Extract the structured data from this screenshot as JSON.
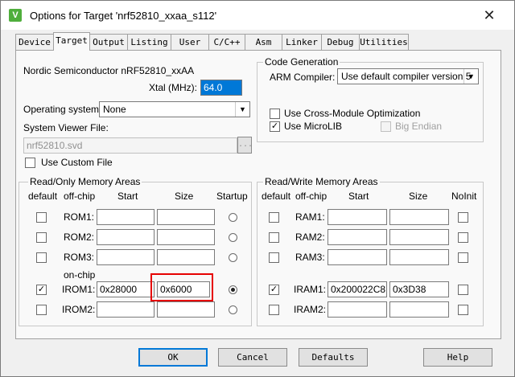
{
  "window": {
    "title": "Options for Target 'nrf52810_xxaa_s112'",
    "icon": "keil-uvision-icon",
    "close": "✕"
  },
  "tabs": [
    {
      "label": "Device"
    },
    {
      "label": "Target"
    },
    {
      "label": "Output"
    },
    {
      "label": "Listing"
    },
    {
      "label": "User"
    },
    {
      "label": "C/C++"
    },
    {
      "label": "Asm"
    },
    {
      "label": "Linker"
    },
    {
      "label": "Debug"
    },
    {
      "label": "Utilities"
    }
  ],
  "target": {
    "device_name": "Nordic Semiconductor nRF52810_xxAA",
    "xtal_label": "Xtal (MHz):",
    "xtal_value": "64.0",
    "os_label": "Operating system:",
    "os_value": "None",
    "svd_label": "System Viewer File:",
    "svd_value": "nrf52810.svd",
    "browse_label": "...",
    "custom_file_label": "Use Custom File"
  },
  "code_gen": {
    "title": "Code Generation",
    "compiler_label": "ARM Compiler:",
    "compiler_value": "Use default compiler version 5",
    "cross_module_label": "Use Cross-Module Optimization",
    "microlib_label": "Use MicroLIB",
    "big_endian_label": "Big Endian"
  },
  "ro_memory": {
    "title": "Read/Only Memory Areas",
    "headers": {
      "default": "default",
      "offchip": "off-chip",
      "start": "Start",
      "size": "Size",
      "startup": "Startup"
    },
    "onchip_label": "on-chip",
    "rows": [
      {
        "label": "ROM1:",
        "start": "",
        "size": ""
      },
      {
        "label": "ROM2:",
        "start": "",
        "size": ""
      },
      {
        "label": "ROM3:",
        "start": "",
        "size": ""
      },
      {
        "label": "IROM1:",
        "start": "0x28000",
        "size": "0x6000"
      },
      {
        "label": "IROM2:",
        "start": "",
        "size": ""
      }
    ]
  },
  "rw_memory": {
    "title": "Read/Write Memory Areas",
    "headers": {
      "default": "default",
      "offchip": "off-chip",
      "start": "Start",
      "size": "Size",
      "noinit": "NoInit"
    },
    "rows": [
      {
        "label": "RAM1:",
        "start": "",
        "size": ""
      },
      {
        "label": "RAM2:",
        "start": "",
        "size": ""
      },
      {
        "label": "RAM3:",
        "start": "",
        "size": ""
      },
      {
        "label": "IRAM1:",
        "start": "0x200022C8",
        "size": "0x3D38"
      },
      {
        "label": "IRAM2:",
        "start": "",
        "size": ""
      }
    ]
  },
  "buttons": {
    "ok": "OK",
    "cancel": "Cancel",
    "defaults": "Defaults",
    "help": "Help"
  },
  "colors": {
    "highlight_box": "#e60000",
    "selection": "#0078d7"
  }
}
